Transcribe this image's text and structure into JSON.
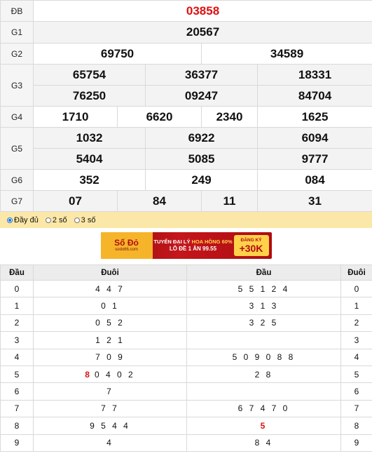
{
  "prizes": [
    {
      "label": "ĐB",
      "values": [
        "03858"
      ]
    },
    {
      "label": "G1",
      "values": [
        "20567"
      ]
    },
    {
      "label": "G2",
      "values": [
        "69750",
        "34589"
      ]
    },
    {
      "label": "G3",
      "values": [
        "65754",
        "36377",
        "18331",
        "76250",
        "09247",
        "84704"
      ]
    },
    {
      "label": "G4",
      "values": [
        "1710",
        "6620",
        "2340",
        "1625"
      ]
    },
    {
      "label": "G5",
      "values": [
        "1032",
        "6922",
        "6094",
        "5404",
        "5085",
        "9777"
      ]
    },
    {
      "label": "G6",
      "values": [
        "352",
        "249",
        "084"
      ]
    },
    {
      "label": "G7",
      "values": [
        "07",
        "84",
        "11",
        "31"
      ]
    }
  ],
  "options": [
    {
      "label": "Đầy đủ",
      "selected": true
    },
    {
      "label": "2 số",
      "selected": false
    },
    {
      "label": "3 số",
      "selected": false
    }
  ],
  "banner": {
    "logo_text": "Số Đỏ",
    "logo_sub": "sodo66.com",
    "line1_a": "TUYỂN ĐẠI LÝ",
    "line1_b": "HOA HỒNG 60%",
    "line2": "LÔ ĐỀ 1 ĂN 99.55",
    "cta_top": "ĐĂNG KÝ",
    "cta_amount": "+30K"
  },
  "loto": {
    "headers": [
      "Đầu",
      "Đuôi",
      "Đầu",
      "Đuôi"
    ],
    "rows": [
      {
        "head": "0",
        "tails": "4 4 7",
        "tails_hot": "",
        "heads": "5 5 1 2 4",
        "heads_hot": "",
        "tail": "0"
      },
      {
        "head": "1",
        "tails": "0 1",
        "tails_hot": "",
        "heads": "3 1 3",
        "heads_hot": "",
        "tail": "1"
      },
      {
        "head": "2",
        "tails": "0 5 2",
        "tails_hot": "",
        "heads": "3 2 5",
        "heads_hot": "",
        "tail": "2"
      },
      {
        "head": "3",
        "tails": "1 2 1",
        "tails_hot": "",
        "heads": "",
        "heads_hot": "",
        "tail": "3"
      },
      {
        "head": "4",
        "tails": "7 0 9",
        "tails_hot": "",
        "heads": "5 0 9 0 8 8",
        "heads_hot": "",
        "tail": "4"
      },
      {
        "head": "5",
        "tails": "0 4 0 2",
        "tails_hot": "8",
        "heads": "2 8",
        "heads_hot": "",
        "tail": "5"
      },
      {
        "head": "6",
        "tails": "7",
        "tails_hot": "",
        "heads": "",
        "heads_hot": "",
        "tail": "6"
      },
      {
        "head": "7",
        "tails": "7 7",
        "tails_hot": "",
        "heads": "6 7 4 7 0",
        "heads_hot": "",
        "tail": "7"
      },
      {
        "head": "8",
        "tails": "9 5 4 4",
        "tails_hot": "",
        "heads": "",
        "heads_hot": "5",
        "tail": "8"
      },
      {
        "head": "9",
        "tails": "4",
        "tails_hot": "",
        "heads": "8 4",
        "heads_hot": "",
        "tail": "9"
      }
    ]
  }
}
